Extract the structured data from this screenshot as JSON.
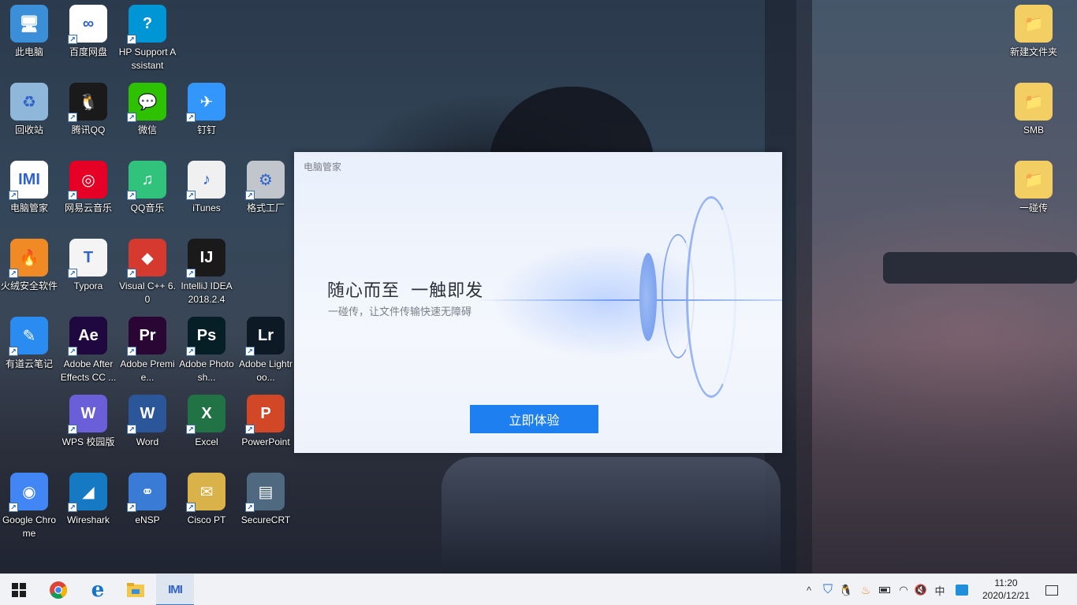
{
  "desktop": {
    "icons": [
      {
        "label": "此电脑",
        "glyph": "🖥",
        "color": "#3b8fd9",
        "icon": "computer-icon"
      },
      {
        "label": "百度网盘",
        "glyph": "∞",
        "color": "#ffffff",
        "icon": "baidu-netdisk-icon"
      },
      {
        "label": "HP Support Assistant",
        "glyph": "?",
        "color": "#0096d6",
        "icon": "hp-support-icon"
      },
      {
        "label": "回收站",
        "glyph": "♻",
        "color": "#8fb7d9",
        "icon": "recycle-bin-icon"
      },
      {
        "label": "腾讯QQ",
        "glyph": "🐧",
        "color": "#1a1a1a",
        "icon": "qq-icon"
      },
      {
        "label": "微信",
        "glyph": "💬",
        "color": "#2dc100",
        "icon": "wechat-icon"
      },
      {
        "label": "钉钉",
        "glyph": "✈",
        "color": "#3296fa",
        "icon": "dingtalk-icon"
      },
      {
        "label": "电脑管家",
        "glyph": "IMI",
        "color": "#ffffff",
        "icon": "pc-manager-icon"
      },
      {
        "label": "网易云音乐",
        "glyph": "◎",
        "color": "#e60026",
        "icon": "netease-music-icon"
      },
      {
        "label": "QQ音乐",
        "glyph": "♫",
        "color": "#31c27c",
        "icon": "qq-music-icon"
      },
      {
        "label": "iTunes",
        "glyph": "♪",
        "color": "#f0f0f0",
        "icon": "itunes-icon"
      },
      {
        "label": "格式工厂",
        "glyph": "⚙",
        "color": "#c0c6cc",
        "icon": "format-factory-icon"
      },
      {
        "label": "火绒安全软件",
        "glyph": "🔥",
        "color": "#f08a24",
        "icon": "huorong-icon"
      },
      {
        "label": "Typora",
        "glyph": "T",
        "color": "#f4f4f4",
        "icon": "typora-icon"
      },
      {
        "label": "Visual C++ 6.0",
        "glyph": "◆",
        "color": "#d63a2f",
        "icon": "visual-cpp-icon"
      },
      {
        "label": "IntelliJ IDEA 2018.2.4",
        "glyph": "IJ",
        "color": "#1a1a1a",
        "icon": "intellij-icon"
      },
      {
        "label": "有道云笔记",
        "glyph": "✎",
        "color": "#2a8cf0",
        "icon": "youdao-note-icon"
      },
      {
        "label": "Adobe After Effects CC ...",
        "glyph": "Ae",
        "color": "#1f0740",
        "icon": "after-effects-icon"
      },
      {
        "label": "Adobe Premie...",
        "glyph": "Pr",
        "color": "#2a0634",
        "icon": "premiere-icon"
      },
      {
        "label": "Adobe Photosh...",
        "glyph": "Ps",
        "color": "#061e26",
        "icon": "photoshop-icon"
      },
      {
        "label": "Adobe Lightroo...",
        "glyph": "Lr",
        "color": "#0d1a26",
        "icon": "lightroom-icon"
      },
      {
        "label": "WPS 校园版",
        "glyph": "W",
        "color": "#6a5fd8",
        "icon": "wps-icon"
      },
      {
        "label": "Word",
        "glyph": "W",
        "color": "#2b579a",
        "icon": "word-icon"
      },
      {
        "label": "Excel",
        "glyph": "X",
        "color": "#217346",
        "icon": "excel-icon"
      },
      {
        "label": "PowerPoint",
        "glyph": "P",
        "color": "#d24726",
        "icon": "powerpoint-icon"
      },
      {
        "label": "Google Chrome",
        "glyph": "◉",
        "color": "#4285f4",
        "icon": "chrome-icon"
      },
      {
        "label": "Wireshark",
        "glyph": "◢",
        "color": "#1679c4",
        "icon": "wireshark-icon"
      },
      {
        "label": "eNSP",
        "glyph": "⚭",
        "color": "#3a7bd5",
        "icon": "ensp-icon"
      },
      {
        "label": "Cisco PT",
        "glyph": "✉",
        "color": "#d9b24a",
        "icon": "cisco-pt-icon"
      },
      {
        "label": "SecureCRT",
        "glyph": "▤",
        "color": "#4f6a80",
        "icon": "securecrt-icon"
      },
      {
        "label": "新建文件夹",
        "glyph": "📁",
        "color": "#f3cf63",
        "icon": "folder-icon"
      },
      {
        "label": "SMB",
        "glyph": "📁",
        "color": "#f3cf63",
        "icon": "folder-icon"
      },
      {
        "label": "一碰传",
        "glyph": "📁",
        "color": "#f3cf63",
        "icon": "folder-icon"
      }
    ]
  },
  "dialog": {
    "title": "电脑管家",
    "headline": "随心而至  一触即发",
    "subtitle": "一碰传，让文件传输快速无障碍",
    "button_label": "立即体验"
  },
  "taskbar": {
    "tray_chevron": "^",
    "input_method": "中",
    "clock_time": "11:20",
    "clock_date": "2020/12/21"
  }
}
